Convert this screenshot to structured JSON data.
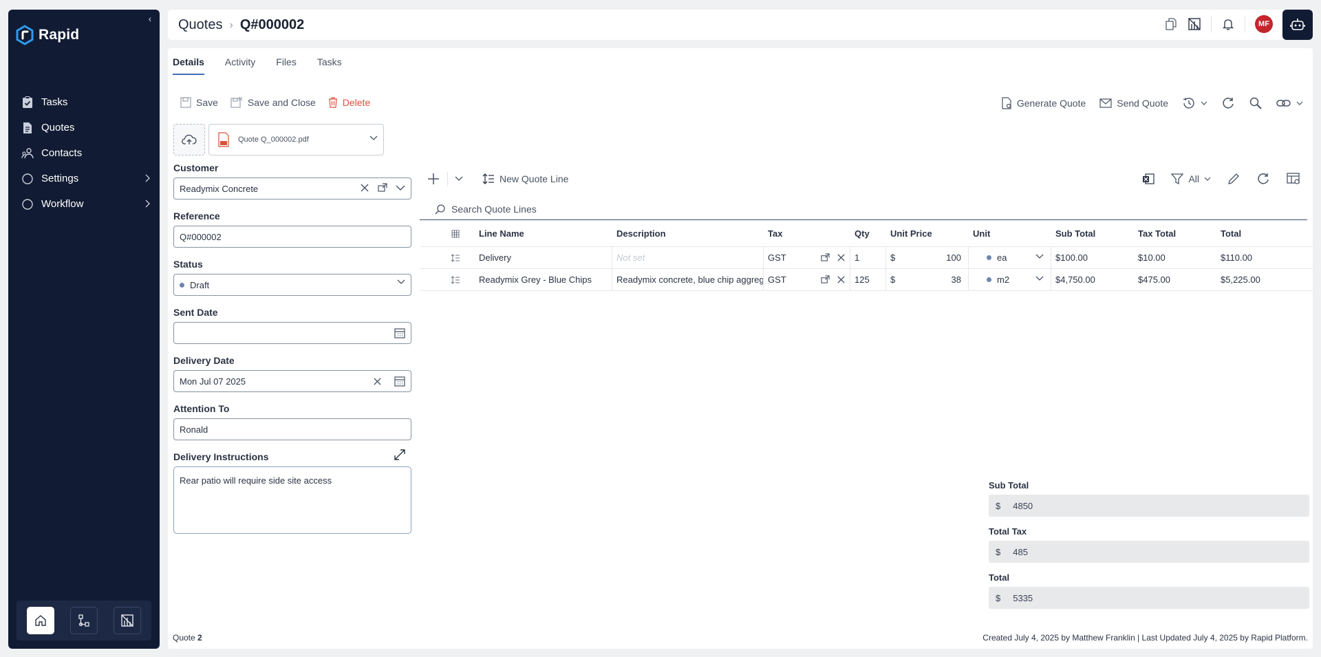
{
  "sidebar": {
    "brand": "Rapid",
    "items": [
      {
        "label": "Tasks",
        "icon": "clipboard-check-icon"
      },
      {
        "label": "Quotes",
        "icon": "document-icon"
      },
      {
        "label": "Contacts",
        "icon": "contacts-icon"
      },
      {
        "label": "Settings",
        "icon": "circle-icon"
      },
      {
        "label": "Workflow",
        "icon": "circle-icon"
      }
    ]
  },
  "header": {
    "breadcrumb_root": "Quotes",
    "breadcrumb_current": "Q#000002",
    "avatar_initials": "MF"
  },
  "tabs": [
    "Details",
    "Activity",
    "Files",
    "Tasks"
  ],
  "toolbar": {
    "save": "Save",
    "save_close": "Save and Close",
    "delete": "Delete",
    "generate_quote": "Generate Quote",
    "send_quote": "Send Quote"
  },
  "file": {
    "name": "Quote Q_000002.pdf"
  },
  "form": {
    "customer_label": "Customer",
    "customer_value": "Readymix Concrete",
    "reference_label": "Reference",
    "reference_value": "Q#000002",
    "status_label": "Status",
    "status_value": "Draft",
    "sent_date_label": "Sent Date",
    "sent_date_value": "",
    "delivery_date_label": "Delivery Date",
    "delivery_date_value": "Mon Jul 07 2025",
    "attention_label": "Attention To",
    "attention_value": "Ronald",
    "instructions_label": "Delivery Instructions",
    "instructions_value": "Rear patio will require side site access"
  },
  "grid": {
    "new_line": "New Quote Line",
    "filter": "All",
    "search_placeholder": "Search Quote Lines",
    "columns": {
      "line_name": "Line Name",
      "description": "Description",
      "tax": "Tax",
      "qty": "Qty",
      "unit_price": "Unit Price",
      "unit": "Unit",
      "sub_total": "Sub Total",
      "tax_total": "Tax Total",
      "total": "Total"
    },
    "rows": [
      {
        "name": "Delivery",
        "description": "Not set",
        "tax": "GST",
        "qty": "1",
        "currency": "$",
        "price": "100",
        "unit": "ea",
        "sub_total": "$100.00",
        "tax_total": "$10.00",
        "total": "$110.00"
      },
      {
        "name": "Readymix Grey - Blue Chips",
        "description": "Readymix concrete, blue chip aggregate",
        "tax": "GST",
        "qty": "125",
        "currency": "$",
        "price": "38",
        "unit": "m2",
        "sub_total": "$4,750.00",
        "tax_total": "$475.00",
        "total": "$5,225.00"
      }
    ]
  },
  "totals": {
    "sub_total_label": "Sub Total",
    "sub_total_value": "4850",
    "total_tax_label": "Total Tax",
    "total_tax_value": "485",
    "total_label": "Total",
    "total_value": "5335",
    "currency": "$"
  },
  "footer": {
    "record_prefix": "Quote",
    "record_number": "2",
    "audit": "Created July 4, 2025 by Matthew Franklin | Last Updated July 4, 2025 by Rapid Platform."
  }
}
